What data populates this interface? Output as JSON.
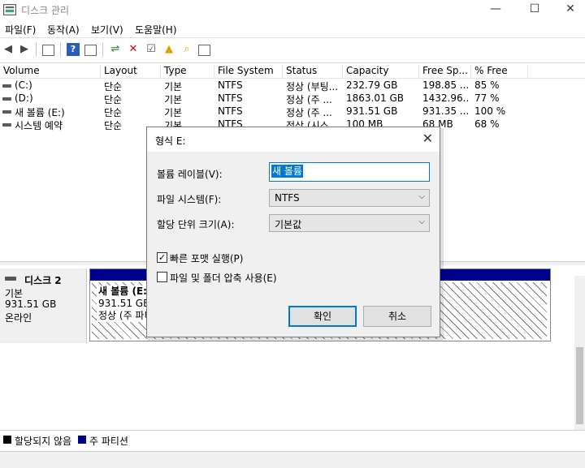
{
  "window": {
    "title": "디스크 관리"
  },
  "menu": [
    "파일(F)",
    "동작(A)",
    "보기(V)",
    "도움말(H)"
  ],
  "volume_table": {
    "headers": [
      "Volume",
      "Layout",
      "Type",
      "File System",
      "Status",
      "Capacity",
      "Free Sp...",
      "% Free"
    ],
    "rows": [
      {
        "volume": "(C:)",
        "layout": "단순",
        "type": "기본",
        "fs": "NTFS",
        "status": "정상 (부팅...",
        "capacity": "232.79 GB",
        "free": "198.85 ...",
        "pct": "85 %"
      },
      {
        "volume": "(D:)",
        "layout": "단순",
        "type": "기본",
        "fs": "NTFS",
        "status": "정상 (주 ...",
        "capacity": "1863.01 GB",
        "free": "1432.96...",
        "pct": "77 %"
      },
      {
        "volume": "새 볼륨 (E:)",
        "layout": "단순",
        "type": "기본",
        "fs": "NTFS",
        "status": "정상 (주 ...",
        "capacity": "931.51 GB",
        "free": "931.35 ...",
        "pct": "100 %"
      },
      {
        "volume": "시스템 예약",
        "layout": "단순",
        "type": "기본",
        "fs": "NTFS",
        "status": "정상 (시스...",
        "capacity": "100 MB",
        "free": "68 MB",
        "pct": "68 %"
      }
    ]
  },
  "disk": {
    "name": "디스크 2",
    "type": "기본",
    "size": "931.51 GB",
    "state": "온라인",
    "partition": {
      "line1": "새 볼륨  (E:)",
      "line2": "931.51 GB N",
      "line3": "정상 (주 파티"
    }
  },
  "legend": [
    {
      "label": "할당되지 않음",
      "color": "#000000"
    },
    {
      "label": "주 파티션",
      "color": "#00008b"
    }
  ],
  "dialog": {
    "title": "형식 E:",
    "volume_label_label": "볼륨 레이블(V):",
    "volume_label_value": "새 볼륨",
    "fs_label": "파일 시스템(F):",
    "fs_value": "NTFS",
    "alloc_label": "할당 단위 크기(A):",
    "alloc_value": "기본값",
    "quick_format_label": "빠른 포맷 실행(P)",
    "quick_format_checked": true,
    "compression_label": "파일 및 폴더 압축 사용(E)",
    "compression_checked": false,
    "ok_label": "확인",
    "cancel_label": "취소"
  },
  "colors": {
    "accent": "#0078d7",
    "primary_partition": "#00008b"
  }
}
